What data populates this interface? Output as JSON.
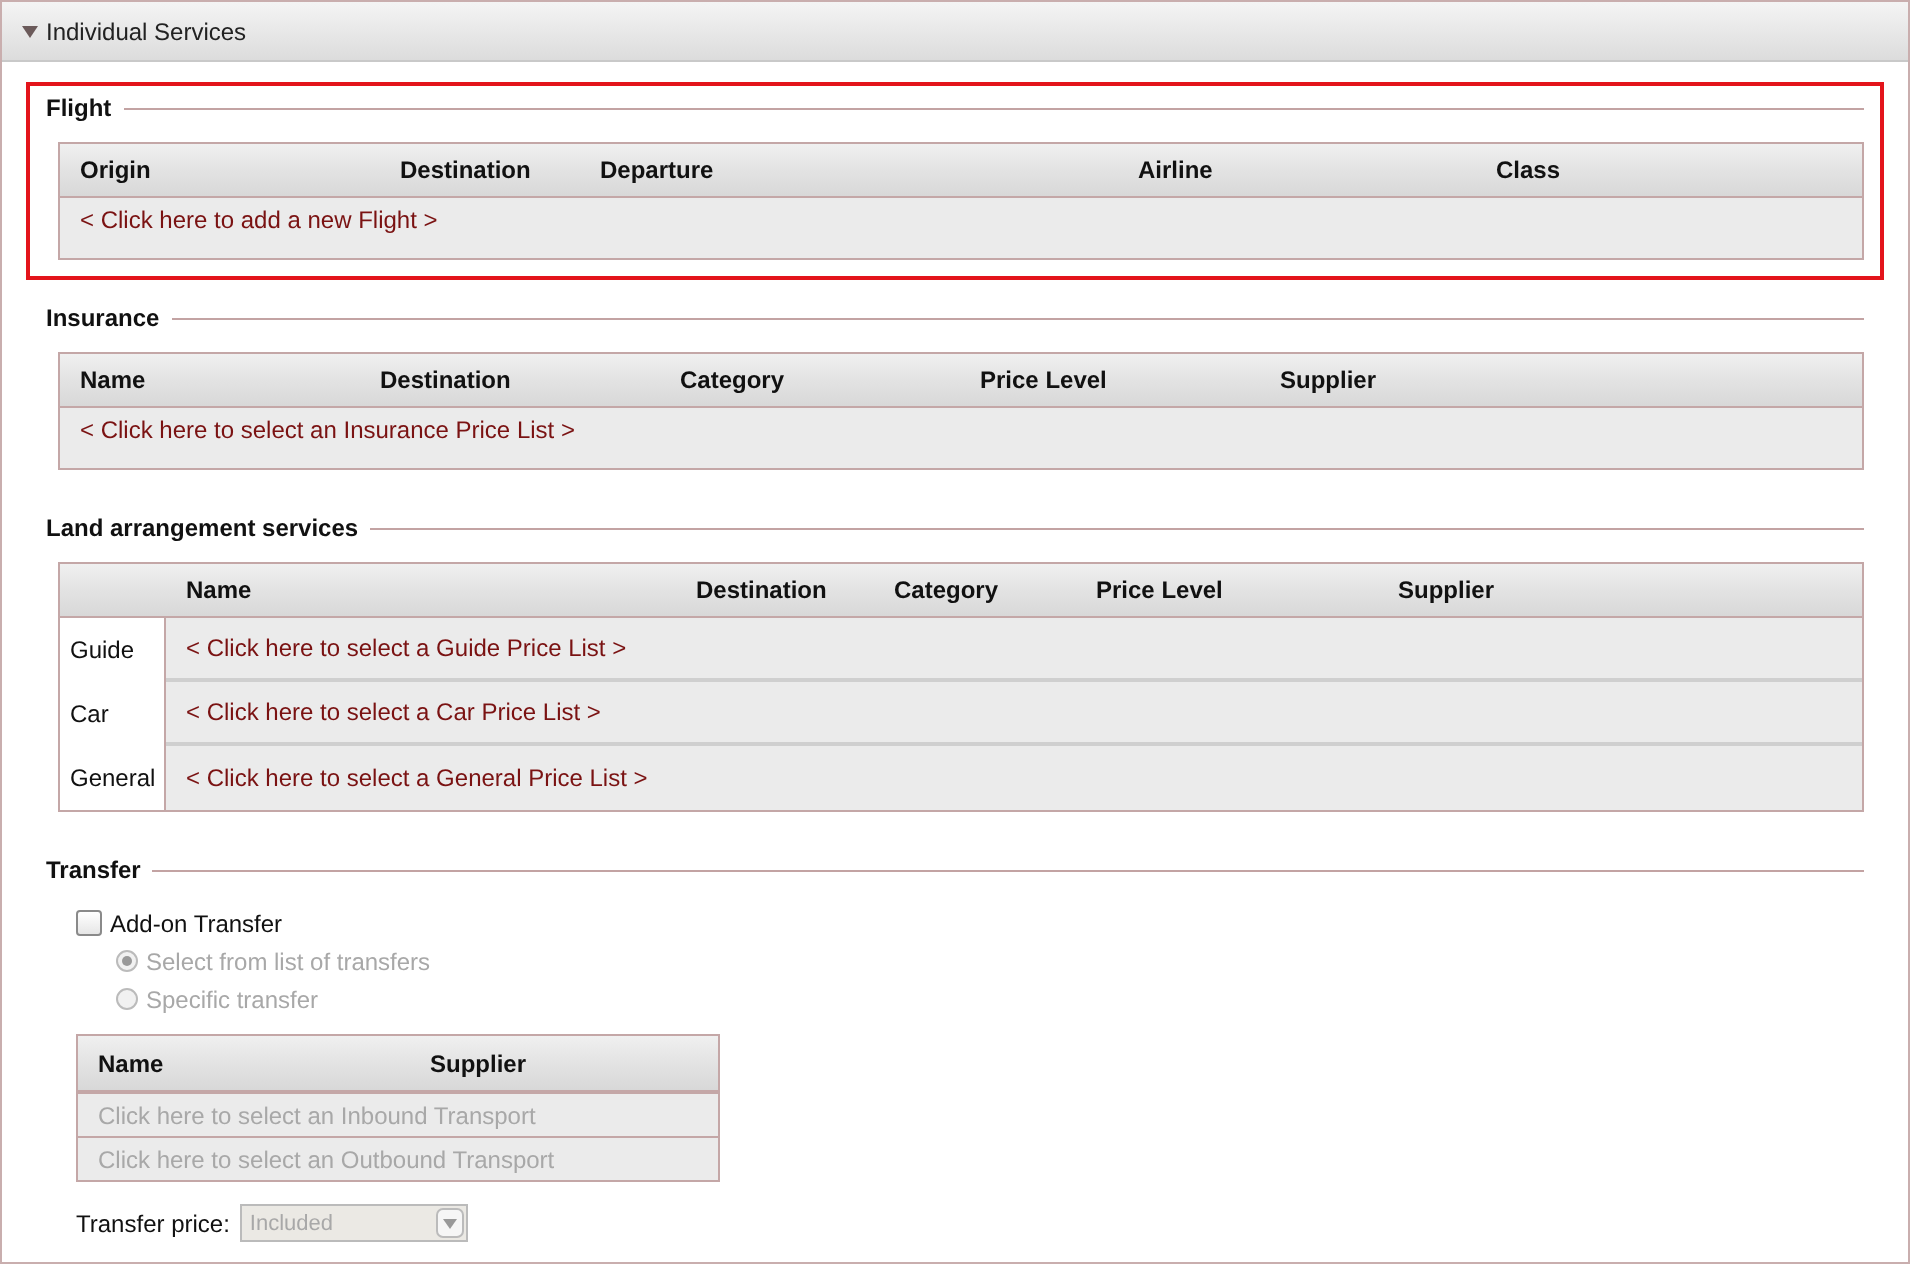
{
  "panel": {
    "title": "Individual Services",
    "expanded": true
  },
  "sections": [
    {
      "kind": "table",
      "title": "Flight",
      "highlighted": true,
      "columns": [
        "Origin",
        "Destination",
        "Departure",
        "Airline",
        "Class"
      ],
      "rows": [
        {
          "action": "< Click here to add a new Flight >"
        }
      ]
    },
    {
      "kind": "table",
      "title": "Insurance",
      "highlighted": false,
      "columns": [
        "Name",
        "Destination",
        "Category",
        "Price Level",
        "Supplier"
      ],
      "rows": [
        {
          "action": "< Click here to select an Insurance Price List >"
        }
      ]
    },
    {
      "kind": "grouped",
      "title": "Land arrangement services",
      "highlighted": false,
      "columns": [
        "Name",
        "Destination",
        "Category",
        "Price Level",
        "Supplier"
      ],
      "rows": [
        {
          "label": "Guide",
          "action": "< Click here to select a Guide Price List >"
        },
        {
          "label": "Car",
          "action": "< Click here to select a Car Price List >"
        },
        {
          "label": "General",
          "action": "< Click here to select a General Price List >"
        }
      ]
    },
    {
      "kind": "transfer",
      "title": "Transfer",
      "highlighted": false,
      "addon": {
        "label": "Add-on Transfer",
        "checked": false
      },
      "options": [
        {
          "label": "Select from list of transfers",
          "selected": true,
          "disabled": true
        },
        {
          "label": "Specific transfer",
          "selected": false,
          "disabled": true
        }
      ],
      "columns": [
        "Name",
        "Supplier"
      ],
      "rows": [
        {
          "action": "Click here to select an Inbound Transport",
          "disabled": true
        },
        {
          "action": "Click here to select an Outbound Transport",
          "disabled": true
        }
      ],
      "price": {
        "label": "Transfer price:",
        "value": "Included",
        "disabled": true
      }
    }
  ]
}
